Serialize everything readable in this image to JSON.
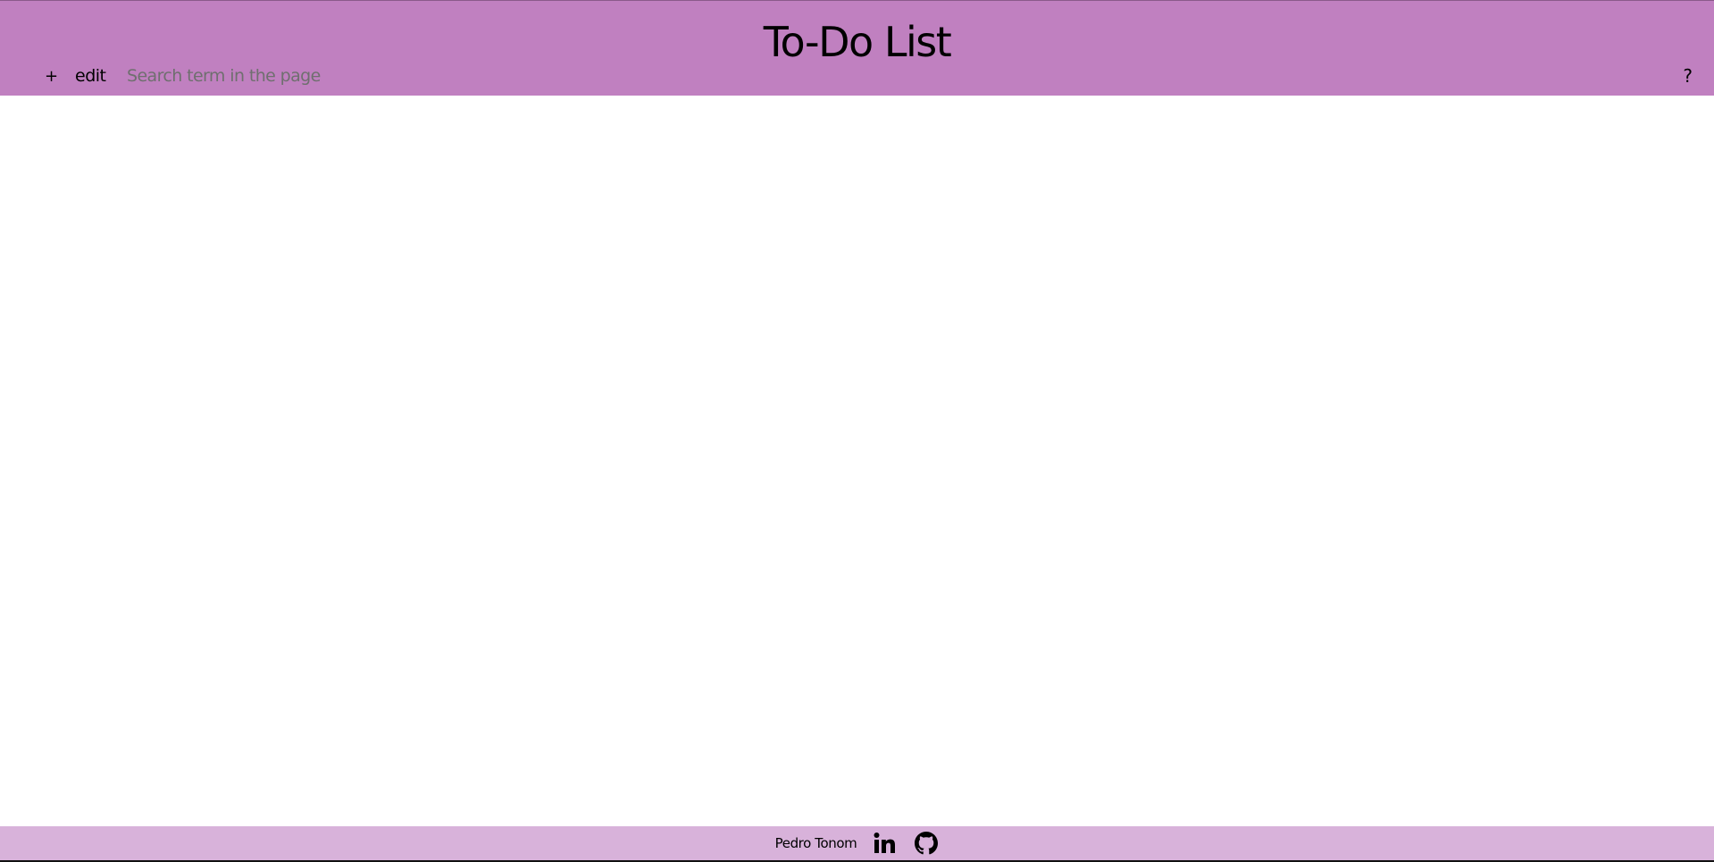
{
  "header": {
    "title": "To-Do List",
    "background_color": "#c080c0"
  },
  "toolbar": {
    "add_label": "+",
    "edit_label": "edit",
    "search_placeholder": "Search term in the page",
    "search_value": "",
    "help_label": "?"
  },
  "footer": {
    "author": "Pedro Tonom",
    "links": [
      {
        "icon": "linkedin-icon"
      },
      {
        "icon": "github-icon"
      }
    ],
    "background_color": "#d8b2da"
  }
}
